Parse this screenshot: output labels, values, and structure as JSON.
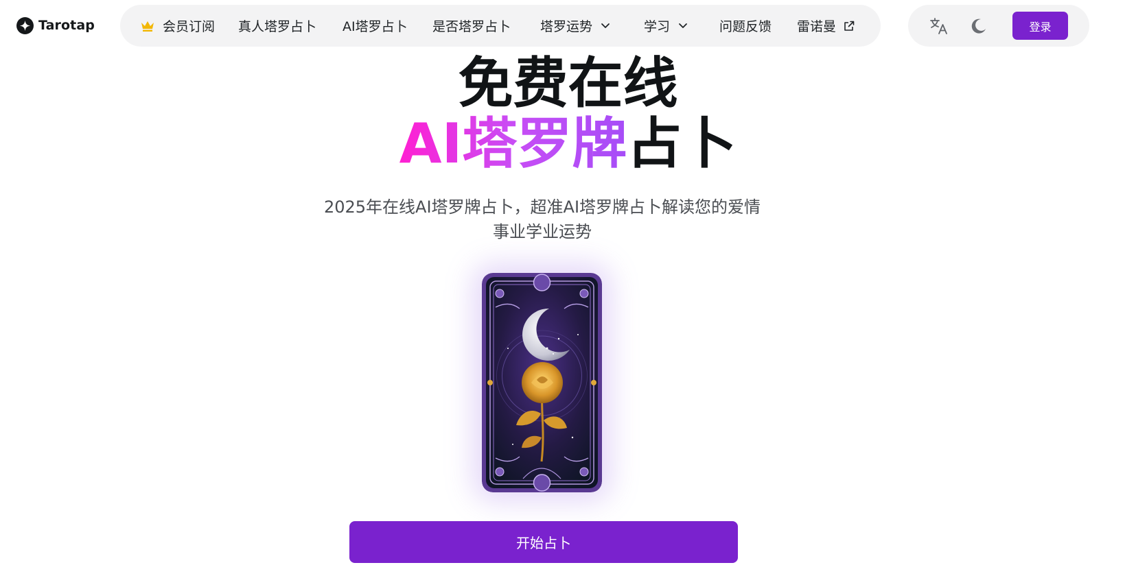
{
  "brand": {
    "name": "Tarotap"
  },
  "nav": {
    "items": [
      {
        "label": "会员订阅",
        "icon": "crown-icon"
      },
      {
        "label": "真人塔罗占卜"
      },
      {
        "label": "AI塔罗占卜"
      },
      {
        "label": "是否塔罗占卜"
      },
      {
        "label": "塔罗运势",
        "icon": "chevron-down-icon"
      },
      {
        "label": "学习",
        "icon": "chevron-down-icon"
      },
      {
        "label": "问题反馈"
      },
      {
        "label": "雷诺曼",
        "icon": "external-link-icon"
      }
    ]
  },
  "toolbar": {
    "translate_icon": "translate-icon",
    "theme_icon": "moon-icon",
    "login_label": "登录"
  },
  "hero": {
    "title_line1": "免费在线",
    "title_highlight": "AI塔罗牌",
    "title_rest": "占卜",
    "subtitle": "2025年在线AI塔罗牌占卜，超准AI塔罗牌占卜解读您的爱情事业学业运势",
    "cta_label": "开始占卜"
  },
  "colors": {
    "accent": "#7a22ce",
    "gradient_start": "#ff1fd2",
    "gradient_end": "#a64df7",
    "crown": "#f2b705"
  }
}
